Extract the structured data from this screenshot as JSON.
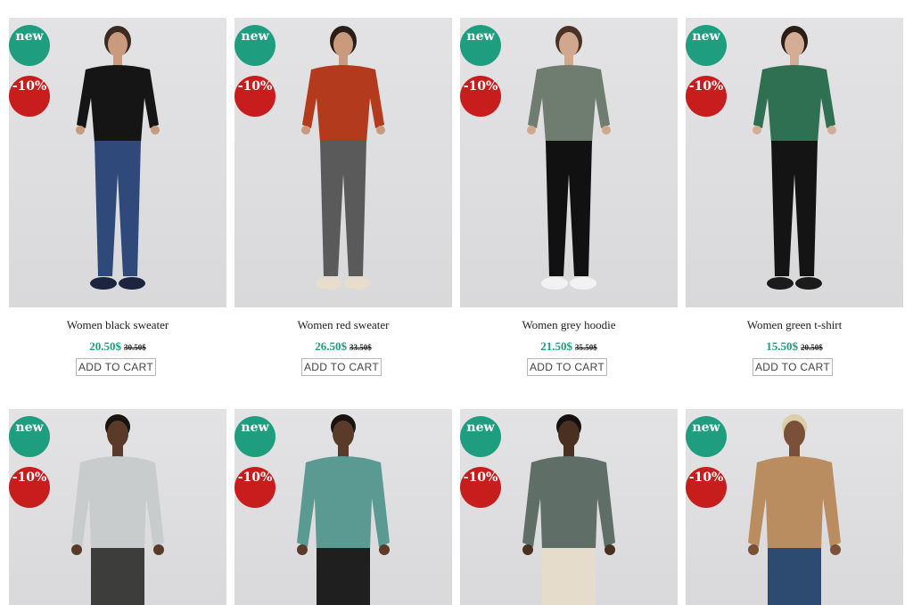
{
  "products": [
    {
      "badge_new": "new",
      "badge_sale": "-10%",
      "title": "Women black sweater",
      "price": "20.50$",
      "old_price": "30.50$",
      "cart": "ADD TO CART",
      "top_color": "#151515",
      "bottom_color": "#2f4a7a",
      "skin": "#c99a7d",
      "hair": "#3a2a20",
      "shoe": "#1c2440"
    },
    {
      "badge_new": "new",
      "badge_sale": "-10%",
      "title": "Women red sweater",
      "price": "26.50$",
      "old_price": "33.50$",
      "cart": "ADD TO CART",
      "top_color": "#b33a1c",
      "bottom_color": "#5a5a5a",
      "skin": "#c99a7d",
      "hair": "#2b1e16",
      "shoe": "#e8dccb"
    },
    {
      "badge_new": "new",
      "badge_sale": "-10%",
      "title": "Women grey hoodie",
      "price": "21.50$",
      "old_price": "35.50$",
      "cart": "ADD TO CART",
      "top_color": "#6e7d6f",
      "bottom_color": "#111111",
      "skin": "#d1a88d",
      "hair": "#4a3326",
      "shoe": "#f2f2f2"
    },
    {
      "badge_new": "new",
      "badge_sale": "-10%",
      "title": "Women green t-shirt",
      "price": "15.50$",
      "old_price": "20.50$",
      "cart": "ADD TO CART",
      "top_color": "#2f7052",
      "bottom_color": "#141414",
      "skin": "#d4ae94",
      "hair": "#2b1e16",
      "shoe": "#1b1b1b"
    },
    {
      "badge_new": "new",
      "badge_sale": "-10%",
      "top_color": "#c9cccc",
      "bottom_color": "#3d3d3b",
      "skin": "#5a3a28",
      "hair": "#1a1410"
    },
    {
      "badge_new": "new",
      "badge_sale": "-10%",
      "top_color": "#5a9a93",
      "bottom_color": "#1f1f1f",
      "skin": "#5a3a28",
      "hair": "#1a1410"
    },
    {
      "badge_new": "new",
      "badge_sale": "-10%",
      "top_color": "#5f6e66",
      "bottom_color": "#e6dccb",
      "skin": "#4a3020",
      "hair": "#151010"
    },
    {
      "badge_new": "new",
      "badge_sale": "-10%",
      "top_color": "#b98d5f",
      "bottom_color": "#2d4a70",
      "skin": "#7a5038",
      "hair": "#d9cfa8"
    }
  ]
}
